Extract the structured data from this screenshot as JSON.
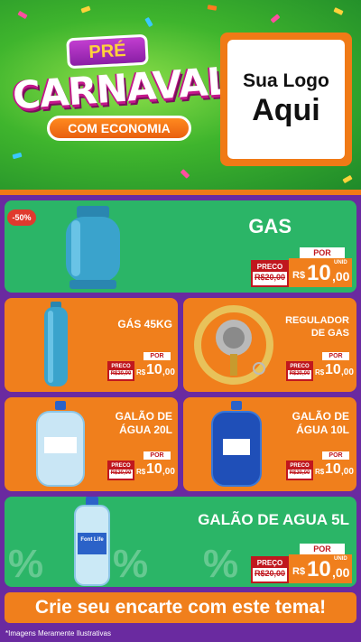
{
  "header": {
    "title_top": "PRÉ",
    "title_main": "CARNAVAL",
    "title_sub": "COM ECONOMIA",
    "logo_line1": "Sua Logo",
    "logo_line2": "Aqui"
  },
  "products": [
    {
      "name": "GAS",
      "badge": "-50%",
      "por": "POR",
      "preco": "PRECO",
      "old": "R$20,00",
      "currency": "R$",
      "price_int": "10",
      "price_dec": ",00",
      "unit": "UNID"
    },
    {
      "name": "GÁS 45KG",
      "por": "POR",
      "preco": "PRECO",
      "old": "R$20,00",
      "currency": "R$",
      "price_int": "10",
      "price_dec": ",00",
      "unit": "UNID"
    },
    {
      "name_line1": "REGULADOR",
      "name_line2": "DE GAS",
      "por": "POR",
      "preco": "PRECO",
      "old": "R$20,00",
      "currency": "R$",
      "price_int": "10",
      "price_dec": ",00",
      "unit": "UNID"
    },
    {
      "name_line1": "GALÃO DE",
      "name_line2": "ÁGUA 20L",
      "por": "POR",
      "preco": "PRECO",
      "old": "R$20,00",
      "currency": "R$",
      "price_int": "10",
      "price_dec": ",00",
      "unit": "UNID"
    },
    {
      "name_line1": "GALÃO DE",
      "name_line2": "ÁGUA 10L",
      "por": "POR",
      "preco": "PRECO",
      "old": "R$20,00",
      "currency": "R$",
      "price_int": "10",
      "price_dec": ",00",
      "unit": "UNID"
    },
    {
      "name": "GALÃO DE AGUA 5L",
      "por": "POR",
      "preco": "PREÇO",
      "old": "R$20,00",
      "currency": "R$",
      "price_int": "10",
      "price_dec": ",00",
      "unit": "UNID",
      "bottle_label": "Font Life"
    }
  ],
  "cta": "Crie seu encarte com este tema!",
  "disclaimer": "*Imagens Meramente Ilustrativas",
  "colors": {
    "green": "#2bb567",
    "orange": "#f07f1c",
    "purple": "#6a2aa0",
    "red": "#c0171e"
  }
}
